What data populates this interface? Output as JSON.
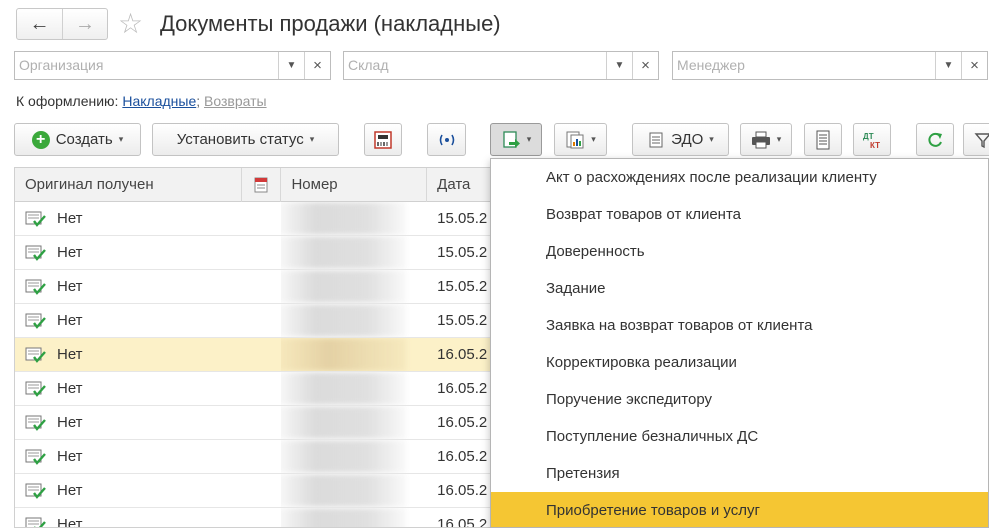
{
  "window": {
    "title": "Документы продажи (накладные)"
  },
  "nav": {
    "back": "←",
    "forward": "→",
    "favorite": "☆"
  },
  "filters": [
    {
      "placeholder": "Организация"
    },
    {
      "placeholder": "Склад"
    },
    {
      "placeholder": "Менеджер"
    }
  ],
  "filter_controls": {
    "dropdown": "▼",
    "clear": "×"
  },
  "processing": {
    "label": "К оформлению:",
    "link1": "Накладные",
    "sep": ";",
    "link2": "Возвраты"
  },
  "toolbar": {
    "create": "Создать",
    "set_status": "Установить статус",
    "edo": "ЭДО",
    "caret": "▾"
  },
  "table": {
    "headers": [
      "Оригинал получен",
      "",
      "Номер",
      "Дата"
    ],
    "rows": [
      {
        "original": "Нет",
        "date": "15.05.2",
        "highlight": false
      },
      {
        "original": "Нет",
        "date": "15.05.2",
        "highlight": false
      },
      {
        "original": "Нет",
        "date": "15.05.2",
        "highlight": false
      },
      {
        "original": "Нет",
        "date": "15.05.2",
        "highlight": false
      },
      {
        "original": "Нет",
        "date": "16.05.2",
        "highlight": true
      },
      {
        "original": "Нет",
        "date": "16.05.2",
        "highlight": false
      },
      {
        "original": "Нет",
        "date": "16.05.2",
        "highlight": false
      },
      {
        "original": "Нет",
        "date": "16.05.2",
        "highlight": false
      },
      {
        "original": "Нет",
        "date": "16.05.2",
        "highlight": false
      },
      {
        "original": "Нет",
        "date": "16.05.2",
        "highlight": false
      }
    ]
  },
  "menu": {
    "items": [
      "Акт о расхождениях после реализации клиенту",
      "Возврат товаров от клиента",
      "Доверенность",
      "Задание",
      "Заявка на возврат товаров от клиента",
      "Корректировка реализации",
      "Поручение экспедитору",
      "Поступление безналичных ДС",
      "Претензия",
      "Приобретение товаров и услуг"
    ],
    "selected_index": 9
  },
  "colors": {
    "accent": "#f5c633",
    "link": "#1a4f9c",
    "row_highlight": "#fcf1c8",
    "check": "#2ea043"
  }
}
